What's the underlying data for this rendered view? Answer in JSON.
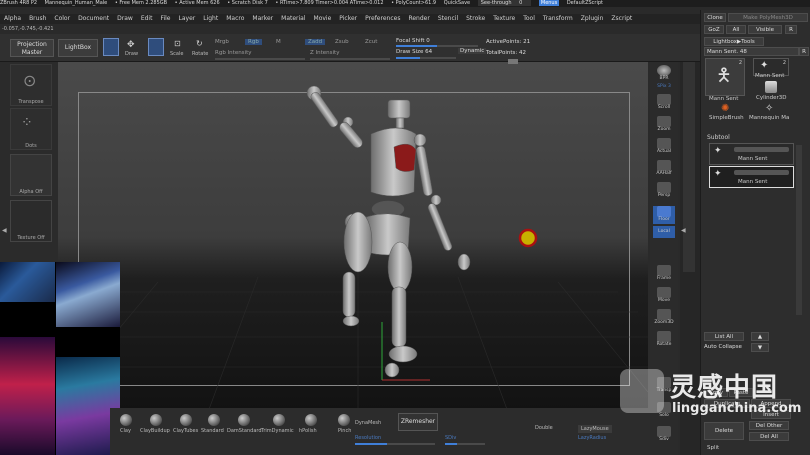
{
  "titlebar": {
    "app": "ZBrush 4R8 P2",
    "file": "Mannequin_Human_Male",
    "free_mem": "• Free Mem 2.285GB",
    "active_mem": "• Active Mem 626",
    "scratch": "• Scratch Disk 7",
    "rtime": "• RTime>7.809 Timer>0.004 ATime>0.012",
    "polycount": "• PolyCount>61.9",
    "quicksave": "QuickSave",
    "see_through": "See-through",
    "see_through_val": "0",
    "menus": "Menus",
    "script": "DefaultZScript"
  },
  "menubar": [
    "Alpha",
    "Brush",
    "Color",
    "Document",
    "Draw",
    "Edit",
    "File",
    "Layer",
    "Light",
    "Macro",
    "Marker",
    "Material",
    "Movie",
    "Picker",
    "Preferences",
    "Render",
    "Stencil",
    "Stroke",
    "Texture",
    "Tool",
    "Transform",
    "Zplugin",
    "Zscript"
  ],
  "coords": "-0.057,-0.745,-0.421",
  "topshelf": {
    "projection_master": "Projection Master",
    "lightbox": "LightBox",
    "edit": "Edit",
    "draw": "Draw",
    "move": "Move",
    "scale": "Scale",
    "rotate": "Rotate",
    "mrgb": "Mrgb",
    "rgb": "Rgb",
    "m": "M",
    "rgb_intensity": "Rgb Intensity",
    "zadd": "Zadd",
    "zsub": "Zsub",
    "zcut": "Zcut",
    "z_intensity": "Z Intensity",
    "focal_shift_label": "Focal Shift",
    "focal_shift_value": "0",
    "draw_size_label": "Draw Size",
    "draw_size_value": "64",
    "dynamic": "Dynamic",
    "active_points": "ActivePoints: 21",
    "total_points": "TotalPoints: 42"
  },
  "leftpanel": {
    "transpose": "Transpose",
    "dots": "Dots",
    "alpha": "Alpha Off",
    "texture": "Texture Off"
  },
  "bottomshelf": {
    "brushes": [
      "Clay",
      "ClayBuildup",
      "ClayTubes",
      "Standard",
      "DamStandard",
      "TrimDynamic",
      "hPolish",
      "Pinch"
    ],
    "dynamesh": "DynaMesh",
    "zremesher": "ZRemesher",
    "double": "Double",
    "lazymouse": "LazyMouse",
    "lazyradius": "LazyRadius",
    "resolution": "Resolution",
    "sdiv": "SDiv"
  },
  "rightshelf": [
    "BPR",
    "SPix 3",
    "Scroll",
    "Zoom",
    "Actual",
    "AAHalf",
    "Persp",
    "Floor",
    "Local",
    "Frame",
    "Move",
    "Zoom3D",
    "Rotate",
    "Transp",
    "Solo",
    "Sdiv"
  ],
  "toolpanel": {
    "clone": "Clone",
    "make_polymesh": "Make PolyMesh3D",
    "goz": "GoZ",
    "all": "All",
    "visible": "Visible",
    "r": "R",
    "lightbox_tools": "Lightbox▶Tools",
    "mann_sent_label": "Mann Sent.",
    "mann_sent_value": "48",
    "tools": [
      {
        "name": "Mann Sent",
        "count": "2"
      },
      {
        "name": "Mann Sent",
        "count": "2"
      },
      {
        "name": "Cylinder3D",
        "count": ""
      },
      {
        "name": "SimpleBrush",
        "count": ""
      },
      {
        "name": "Mannequin Ma",
        "count": ""
      }
    ],
    "subtool": "Subtool",
    "subtools": [
      "Mann Sent",
      "Mann Sent"
    ],
    "list_all": "List All",
    "auto_collapse": "Auto Collapse",
    "copy": "Copy",
    "paste": "Paste",
    "duplicate": "Duplicate",
    "append": "Append",
    "insert": "Insert",
    "delete": "Delete",
    "del_other": "Del Other",
    "del_all": "Del All",
    "split": "Split"
  },
  "watermark": {
    "cn": "灵感中国",
    "url": "lingganchina.com"
  },
  "colors": {
    "accent": "#3f7fd9",
    "bg": "#2a2a2a",
    "highlight_red": "#8b1a1a"
  }
}
